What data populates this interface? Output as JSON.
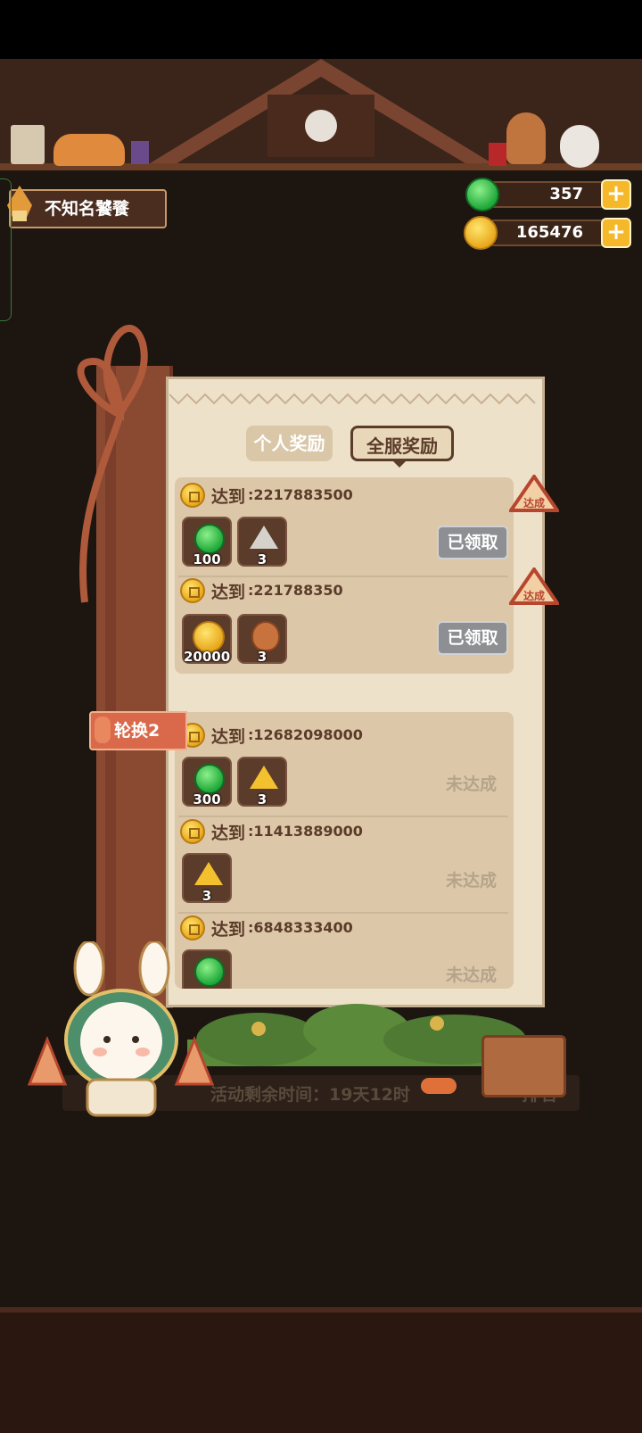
{
  "player": {
    "name": "不知名饕餮"
  },
  "resources": {
    "gems": {
      "value": "357",
      "icon": "green-gem-icon"
    },
    "coins": {
      "value": "165476",
      "icon": "gold-coin-icon"
    }
  },
  "tabs": [
    {
      "label": "个人奖励",
      "active": false
    },
    {
      "label": "全服奖励",
      "active": true
    }
  ],
  "rotation_label": "轮换2",
  "rewards": [
    {
      "reach_label": "达到",
      "target": ":2217883500",
      "items": [
        {
          "type": "gem",
          "count": "100"
        },
        {
          "type": "silver-tri",
          "count": "3"
        }
      ],
      "status": "已领取",
      "done_badge": "达成"
    },
    {
      "reach_label": "达到",
      "target": ":221788350",
      "items": [
        {
          "type": "coin",
          "count": "20000"
        },
        {
          "type": "pouch",
          "count": "3"
        }
      ],
      "status": "已领取",
      "done_badge": "达成"
    },
    {
      "reach_label": "达到",
      "target": ":12682098000",
      "items": [
        {
          "type": "gem",
          "count": "300"
        },
        {
          "type": "gold-tri",
          "count": "3"
        }
      ],
      "status": "未达成"
    },
    {
      "reach_label": "达到",
      "target": ":11413889000",
      "items": [
        {
          "type": "gold-tri",
          "count": "3"
        }
      ],
      "status": "未达成"
    },
    {
      "reach_label": "达到",
      "target": ":6848333400",
      "items": [
        {
          "type": "gem",
          "count": ""
        }
      ],
      "status": "未达成"
    }
  ],
  "footer": {
    "timer": "活动剩余时间：19天12时",
    "rank_button": "排名"
  },
  "colors": {
    "panel_paper": "#eee1c9",
    "wood": "#8a4a32",
    "button_claimed": "#8d8f93",
    "tag": "#d9694a"
  }
}
